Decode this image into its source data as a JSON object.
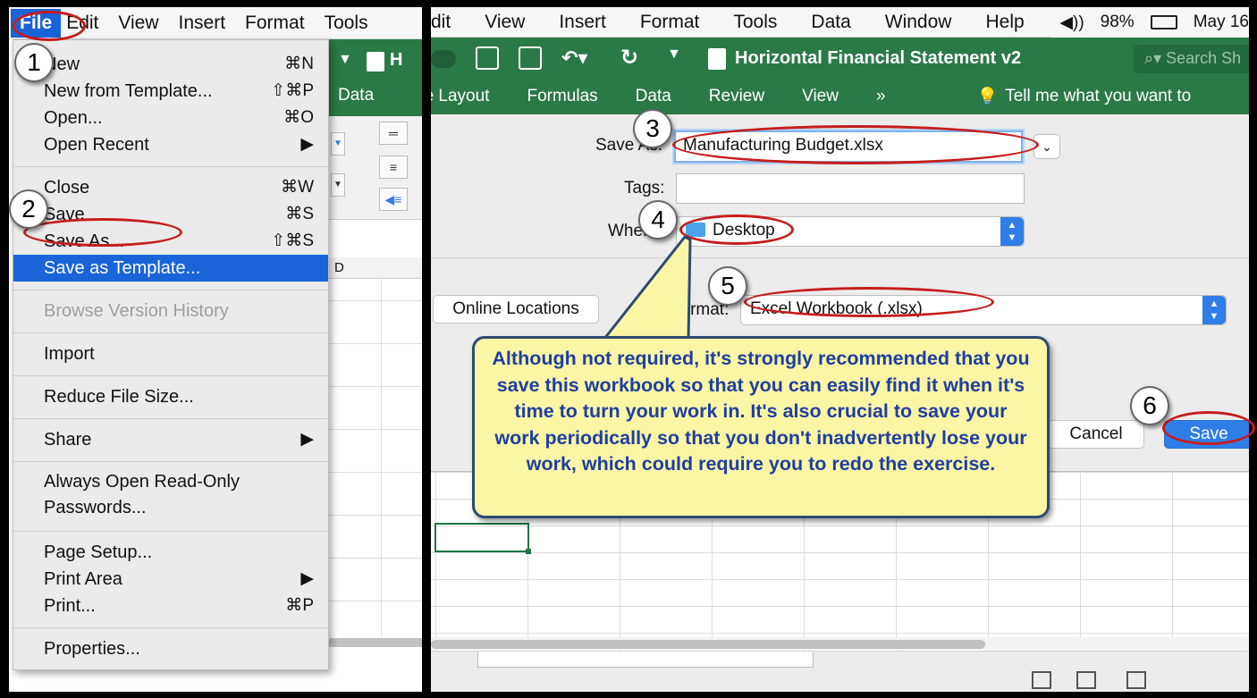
{
  "left": {
    "menubar": [
      "File",
      "Edit",
      "View",
      "Insert",
      "Format",
      "Tools"
    ],
    "ribbon_tab": "Data",
    "col_header": "D",
    "title_fragment": "H",
    "file_menu": {
      "new": {
        "label": "New",
        "shortcut": "⌘N"
      },
      "new_from_template": {
        "label": "New from Template...",
        "shortcut": "⇧⌘P"
      },
      "open": {
        "label": "Open...",
        "shortcut": "⌘O"
      },
      "open_recent": {
        "label": "Open Recent",
        "arrow": "▶"
      },
      "close": {
        "label": "Close",
        "shortcut": "⌘W"
      },
      "save": {
        "label": "Save",
        "shortcut": "⌘S"
      },
      "save_as": {
        "label": "Save As...",
        "shortcut": "⇧⌘S"
      },
      "save_as_template": {
        "label": "Save as Template..."
      },
      "browse_history": {
        "label": "Browse Version History"
      },
      "import": {
        "label": "Import"
      },
      "reduce": {
        "label": "Reduce File Size..."
      },
      "share": {
        "label": "Share",
        "arrow": "▶"
      },
      "always_open": {
        "line1": "Always Open Read-Only",
        "line2": "Passwords..."
      },
      "page_setup": {
        "label": "Page Setup..."
      },
      "print_area": {
        "label": "Print Area",
        "arrow": "▶"
      },
      "print": {
        "label": "Print...",
        "shortcut": "⌘P"
      },
      "properties": {
        "label": "Properties..."
      }
    }
  },
  "right": {
    "menubar": [
      "dit",
      "View",
      "Insert",
      "Format",
      "Tools",
      "Data",
      "Window",
      "Help"
    ],
    "status": {
      "volume": "◀))",
      "battery": "98%",
      "date": "May 16"
    },
    "doc_title": "Horizontal Financial Statement v2",
    "search_placeholder": "Search Sh",
    "ribbon_tabs": [
      "ge Layout",
      "Formulas",
      "Data",
      "Review",
      "View",
      "»"
    ],
    "tell_me": "Tell me what you want to",
    "dialog": {
      "save_as_label": "Save As:",
      "filename": "Manufacturing Budget.xlsx",
      "tags_label": "Tags:",
      "where_label": "Where:",
      "where_value": "Desktop",
      "online_locations": "Online Locations",
      "file_format_label": "File Format:",
      "file_format_value": "Excel Workbook (.xlsx)",
      "cancel": "Cancel",
      "save": "Save"
    }
  },
  "annotations": {
    "steps": [
      "1",
      "2",
      "3",
      "4",
      "5",
      "6"
    ],
    "callout": "Although not required, it's strongly recommended that you save this workbook so that you can easily find it when it's time to turn your work in. It's also crucial to save your work periodically so that you don't inadvertently lose your work, which could require you to redo the exercise."
  }
}
